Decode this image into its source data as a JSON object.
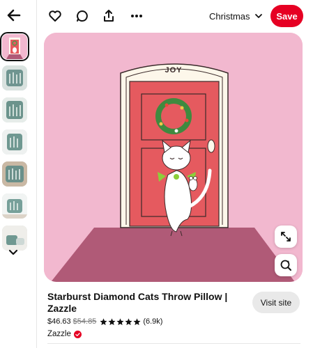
{
  "nav": {
    "back_icon": "arrow-left-icon"
  },
  "thumbnails": [
    {
      "id": "thumb-1",
      "icon": "pink-cat-thumbnail"
    },
    {
      "id": "thumb-2",
      "icon": "pillow-thumbnail"
    },
    {
      "id": "thumb-3",
      "icon": "pillow-thumbnail"
    },
    {
      "id": "thumb-4",
      "icon": "pillow-thumbnail"
    },
    {
      "id": "thumb-5",
      "icon": "pillow-thumbnail"
    },
    {
      "id": "thumb-6",
      "icon": "pillow-thumbnail"
    },
    {
      "id": "thumb-7",
      "icon": "pillow-thumbnail"
    }
  ],
  "toolbar": {
    "icons": [
      "heart-icon",
      "comment-icon",
      "share-icon",
      "more-icon"
    ],
    "board_label": "Christmas",
    "save_label": "Save",
    "save_color": "#e60023"
  },
  "image": {
    "door_sign": "JOY",
    "background_color": "#f2b8cf",
    "door_color": "#e55a5f"
  },
  "product": {
    "title": "Starburst Diamond Cats Throw Pillow | Zazzle",
    "price": "$46.63",
    "old_price": "$54.85",
    "rating_stars": 5,
    "review_count": "(6.9k)",
    "merchant": "Zazzle",
    "visit_label": "Visit site"
  }
}
